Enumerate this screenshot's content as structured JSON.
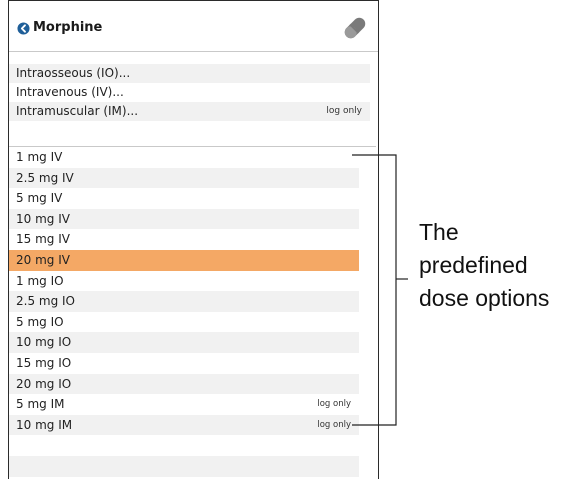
{
  "header": {
    "title": "Morphine",
    "back_icon": "circle-arrow-left-icon",
    "pill_icon": "pill-capsule-icon"
  },
  "routes": [
    {
      "label": "Intraosseous (IO)...",
      "tag": ""
    },
    {
      "label": "Intravenous (IV)...",
      "tag": ""
    },
    {
      "label": "Intramuscular (IM)...",
      "tag": "log only"
    }
  ],
  "doses": [
    {
      "label": "1 mg IV",
      "tag": ""
    },
    {
      "label": "2.5 mg IV",
      "tag": ""
    },
    {
      "label": "5 mg IV",
      "tag": ""
    },
    {
      "label": "10 mg IV",
      "tag": ""
    },
    {
      "label": "15 mg IV",
      "tag": ""
    },
    {
      "label": "20 mg IV",
      "tag": "",
      "selected": true
    },
    {
      "label": "1 mg IO",
      "tag": ""
    },
    {
      "label": "2.5 mg IO",
      "tag": ""
    },
    {
      "label": "5 mg IO",
      "tag": ""
    },
    {
      "label": "10 mg IO",
      "tag": ""
    },
    {
      "label": "15 mg IO",
      "tag": ""
    },
    {
      "label": "20 mg IO",
      "tag": ""
    },
    {
      "label": "5 mg IM",
      "tag": "log only"
    },
    {
      "label": "10 mg IM",
      "tag": "log only"
    }
  ],
  "annotation": {
    "lines": [
      "The",
      "predefined",
      "dose options"
    ]
  },
  "colors": {
    "selected_row": "#f4a865",
    "alt_row": "#f1f1f1",
    "back_icon": "#1f5f99"
  }
}
